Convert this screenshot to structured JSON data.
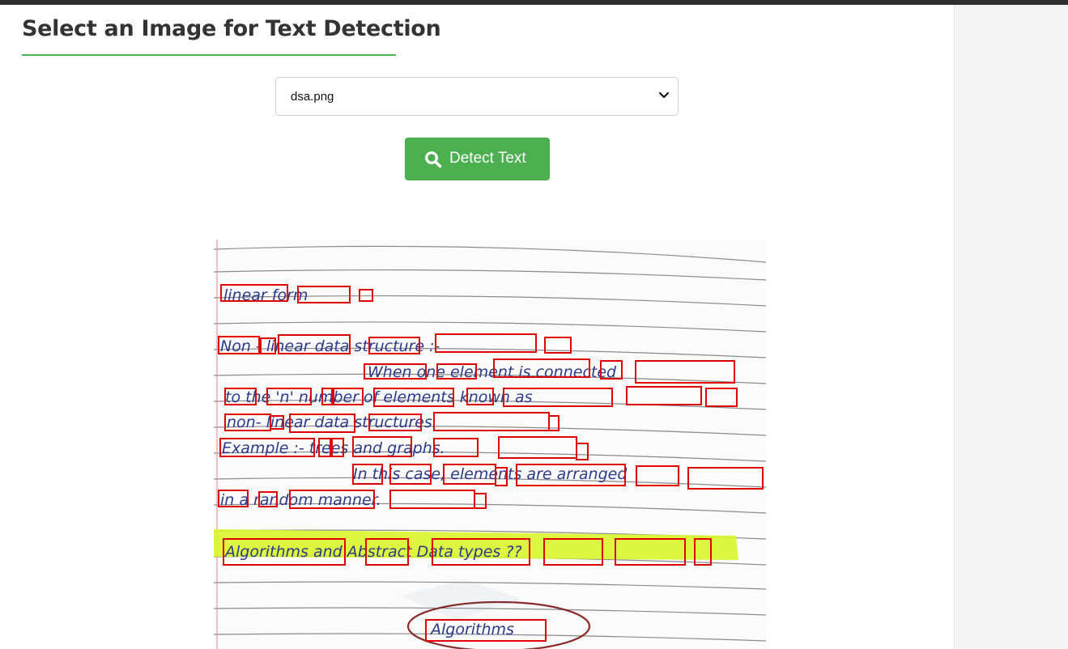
{
  "page": {
    "title": "Select an Image for Text Detection"
  },
  "image_select": {
    "selected": "dsa.png"
  },
  "detect_button": {
    "label": "Detect Text",
    "icon": "search-icon",
    "color": "#4caf50"
  },
  "result_image": {
    "description": "scanned handwritten notebook page with red text-detection bounding boxes",
    "box_color": "#e00000",
    "highlight_color": "#d9f52b",
    "handwritten_lines": [
      "linear form .",
      "Non - linear data structure :-",
      "When one element is connected",
      "to the 'n' number of elements known as",
      "non-linear data structures.",
      "Example :- trees and graphs.",
      "In this case, elements are arranged",
      "in a random manner.",
      "Algorithms and Abstract Data types ??",
      "Algorithms"
    ]
  }
}
